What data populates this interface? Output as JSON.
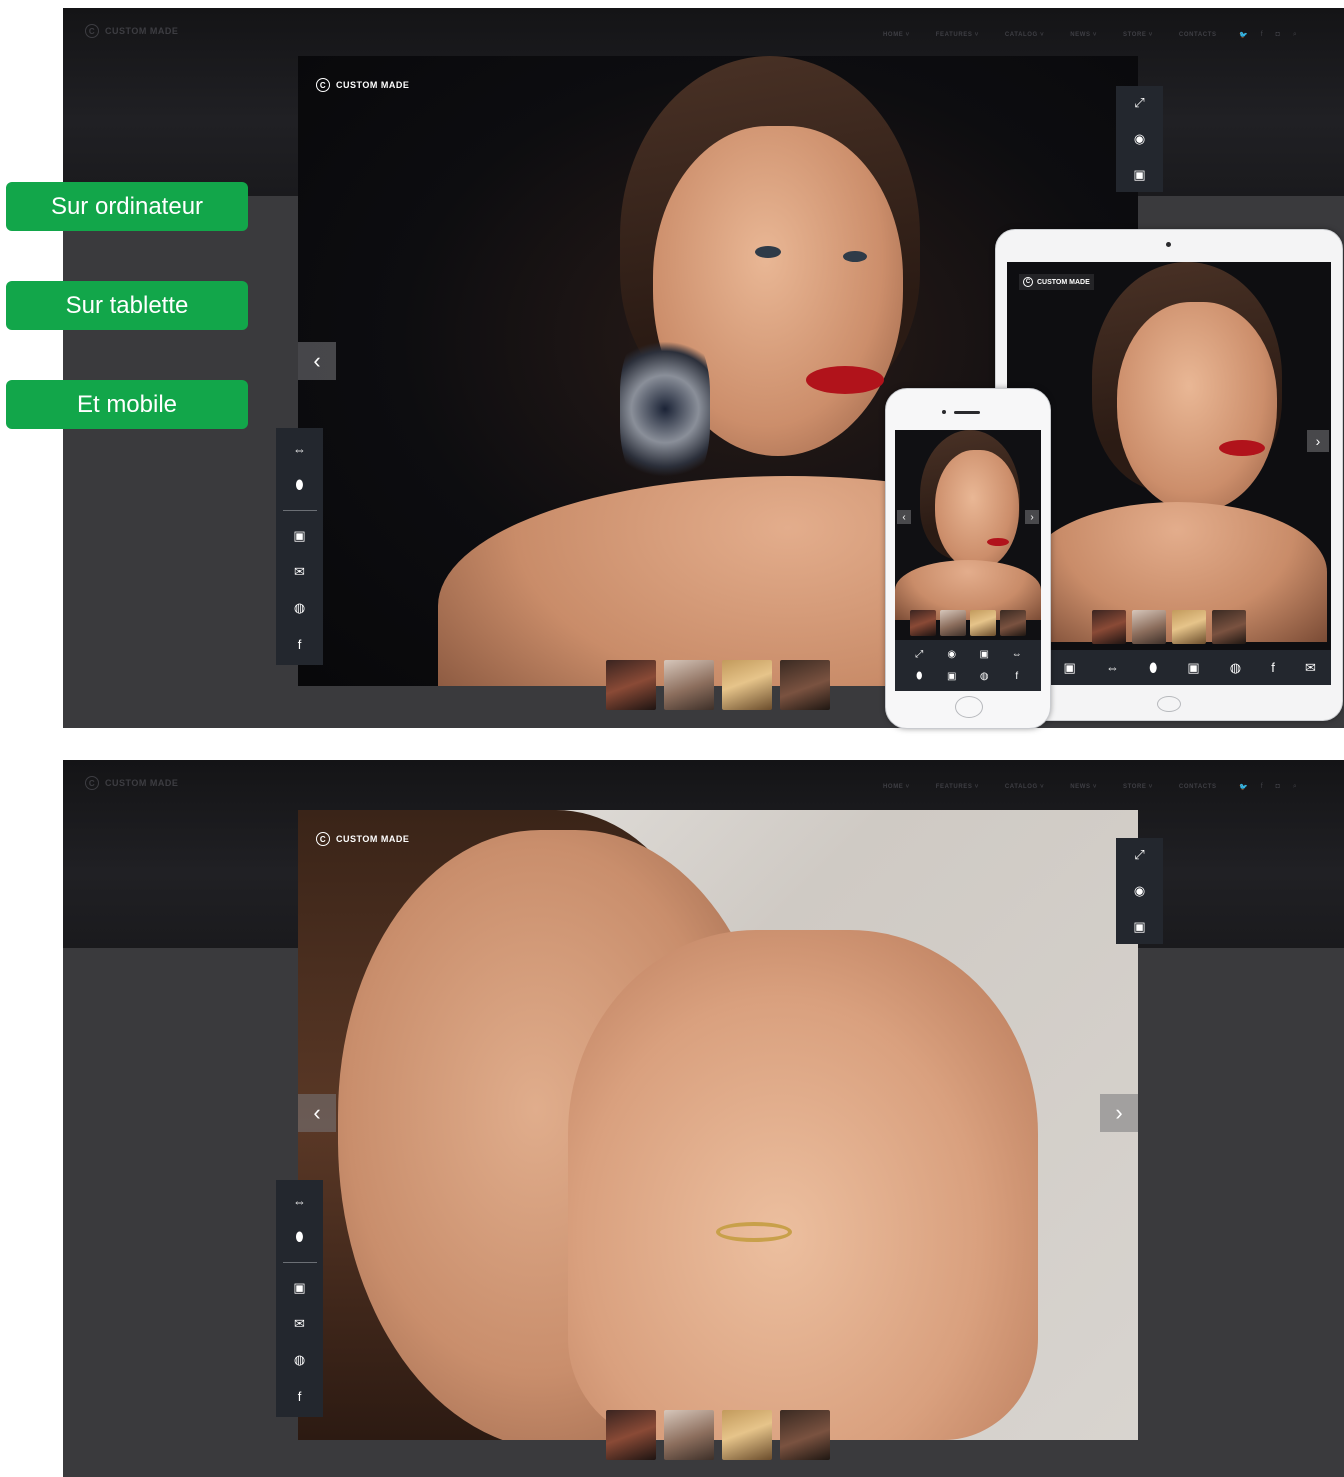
{
  "site": {
    "brand": "CUSTOM MADE",
    "nav": [
      "HOME ˅",
      "FEATURES ˅",
      "CATALOG ˅",
      "NEWS ˅",
      "STORE ˅",
      "CONTACTS"
    ],
    "social_icons": [
      "twitter-icon",
      "facebook-icon",
      "instagram-icon",
      "search-icon"
    ]
  },
  "labels": {
    "desktop": "Sur ordinateur",
    "tablet": "Sur tablette",
    "mobile": "Et mobile"
  },
  "viewer": {
    "logo_text": "CUSTOM MADE",
    "right_toolbar": [
      "fullscreen-icon",
      "webcam-icon",
      "display-icon"
    ],
    "left_toolbar_top": [
      "rotate-icon",
      "scroll-icon"
    ],
    "left_toolbar_bottom": [
      "camera-icon",
      "email-icon",
      "whatsapp-icon",
      "facebook-icon"
    ],
    "thumbnails": [
      "model-1",
      "model-2",
      "model-3",
      "model-4"
    ]
  },
  "tablet": {
    "logo_text": "CUSTOM MADE",
    "toolbar": [
      "webcam-icon",
      "display-icon",
      "rotate-icon",
      "scroll-icon",
      "camera-icon",
      "whatsapp-icon",
      "facebook-icon",
      "email-icon"
    ]
  },
  "phone": {
    "toolbar": [
      "fullscreen-icon",
      "webcam-icon",
      "display-icon",
      "rotate-icon",
      "scroll-icon",
      "camera-icon",
      "whatsapp-icon",
      "facebook-icon"
    ]
  },
  "colors": {
    "label_green": "#12a64a",
    "toolbar_bg": "#23272e",
    "panel_bg": "#3a3a3d",
    "lip_red": "#b1131b"
  }
}
